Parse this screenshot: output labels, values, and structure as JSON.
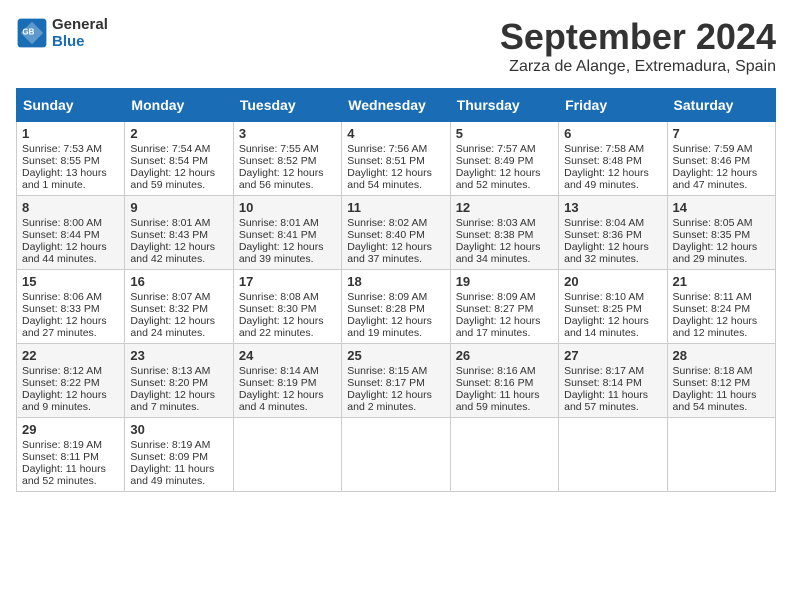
{
  "header": {
    "logo_line1": "General",
    "logo_line2": "Blue",
    "title": "September 2024",
    "subtitle": "Zarza de Alange, Extremadura, Spain"
  },
  "weekdays": [
    "Sunday",
    "Monday",
    "Tuesday",
    "Wednesday",
    "Thursday",
    "Friday",
    "Saturday"
  ],
  "weeks": [
    [
      {
        "day": "1",
        "sunrise": "7:53 AM",
        "sunset": "8:55 PM",
        "daylight": "13 hours and 1 minute."
      },
      {
        "day": "2",
        "sunrise": "7:54 AM",
        "sunset": "8:54 PM",
        "daylight": "12 hours and 59 minutes."
      },
      {
        "day": "3",
        "sunrise": "7:55 AM",
        "sunset": "8:52 PM",
        "daylight": "12 hours and 56 minutes."
      },
      {
        "day": "4",
        "sunrise": "7:56 AM",
        "sunset": "8:51 PM",
        "daylight": "12 hours and 54 minutes."
      },
      {
        "day": "5",
        "sunrise": "7:57 AM",
        "sunset": "8:49 PM",
        "daylight": "12 hours and 52 minutes."
      },
      {
        "day": "6",
        "sunrise": "7:58 AM",
        "sunset": "8:48 PM",
        "daylight": "12 hours and 49 minutes."
      },
      {
        "day": "7",
        "sunrise": "7:59 AM",
        "sunset": "8:46 PM",
        "daylight": "12 hours and 47 minutes."
      }
    ],
    [
      {
        "day": "8",
        "sunrise": "8:00 AM",
        "sunset": "8:44 PM",
        "daylight": "12 hours and 44 minutes."
      },
      {
        "day": "9",
        "sunrise": "8:01 AM",
        "sunset": "8:43 PM",
        "daylight": "12 hours and 42 minutes."
      },
      {
        "day": "10",
        "sunrise": "8:01 AM",
        "sunset": "8:41 PM",
        "daylight": "12 hours and 39 minutes."
      },
      {
        "day": "11",
        "sunrise": "8:02 AM",
        "sunset": "8:40 PM",
        "daylight": "12 hours and 37 minutes."
      },
      {
        "day": "12",
        "sunrise": "8:03 AM",
        "sunset": "8:38 PM",
        "daylight": "12 hours and 34 minutes."
      },
      {
        "day": "13",
        "sunrise": "8:04 AM",
        "sunset": "8:36 PM",
        "daylight": "12 hours and 32 minutes."
      },
      {
        "day": "14",
        "sunrise": "8:05 AM",
        "sunset": "8:35 PM",
        "daylight": "12 hours and 29 minutes."
      }
    ],
    [
      {
        "day": "15",
        "sunrise": "8:06 AM",
        "sunset": "8:33 PM",
        "daylight": "12 hours and 27 minutes."
      },
      {
        "day": "16",
        "sunrise": "8:07 AM",
        "sunset": "8:32 PM",
        "daylight": "12 hours and 24 minutes."
      },
      {
        "day": "17",
        "sunrise": "8:08 AM",
        "sunset": "8:30 PM",
        "daylight": "12 hours and 22 minutes."
      },
      {
        "day": "18",
        "sunrise": "8:09 AM",
        "sunset": "8:28 PM",
        "daylight": "12 hours and 19 minutes."
      },
      {
        "day": "19",
        "sunrise": "8:09 AM",
        "sunset": "8:27 PM",
        "daylight": "12 hours and 17 minutes."
      },
      {
        "day": "20",
        "sunrise": "8:10 AM",
        "sunset": "8:25 PM",
        "daylight": "12 hours and 14 minutes."
      },
      {
        "day": "21",
        "sunrise": "8:11 AM",
        "sunset": "8:24 PM",
        "daylight": "12 hours and 12 minutes."
      }
    ],
    [
      {
        "day": "22",
        "sunrise": "8:12 AM",
        "sunset": "8:22 PM",
        "daylight": "12 hours and 9 minutes."
      },
      {
        "day": "23",
        "sunrise": "8:13 AM",
        "sunset": "8:20 PM",
        "daylight": "12 hours and 7 minutes."
      },
      {
        "day": "24",
        "sunrise": "8:14 AM",
        "sunset": "8:19 PM",
        "daylight": "12 hours and 4 minutes."
      },
      {
        "day": "25",
        "sunrise": "8:15 AM",
        "sunset": "8:17 PM",
        "daylight": "12 hours and 2 minutes."
      },
      {
        "day": "26",
        "sunrise": "8:16 AM",
        "sunset": "8:16 PM",
        "daylight": "11 hours and 59 minutes."
      },
      {
        "day": "27",
        "sunrise": "8:17 AM",
        "sunset": "8:14 PM",
        "daylight": "11 hours and 57 minutes."
      },
      {
        "day": "28",
        "sunrise": "8:18 AM",
        "sunset": "8:12 PM",
        "daylight": "11 hours and 54 minutes."
      }
    ],
    [
      {
        "day": "29",
        "sunrise": "8:19 AM",
        "sunset": "8:11 PM",
        "daylight": "11 hours and 52 minutes."
      },
      {
        "day": "30",
        "sunrise": "8:19 AM",
        "sunset": "8:09 PM",
        "daylight": "11 hours and 49 minutes."
      },
      null,
      null,
      null,
      null,
      null
    ]
  ]
}
